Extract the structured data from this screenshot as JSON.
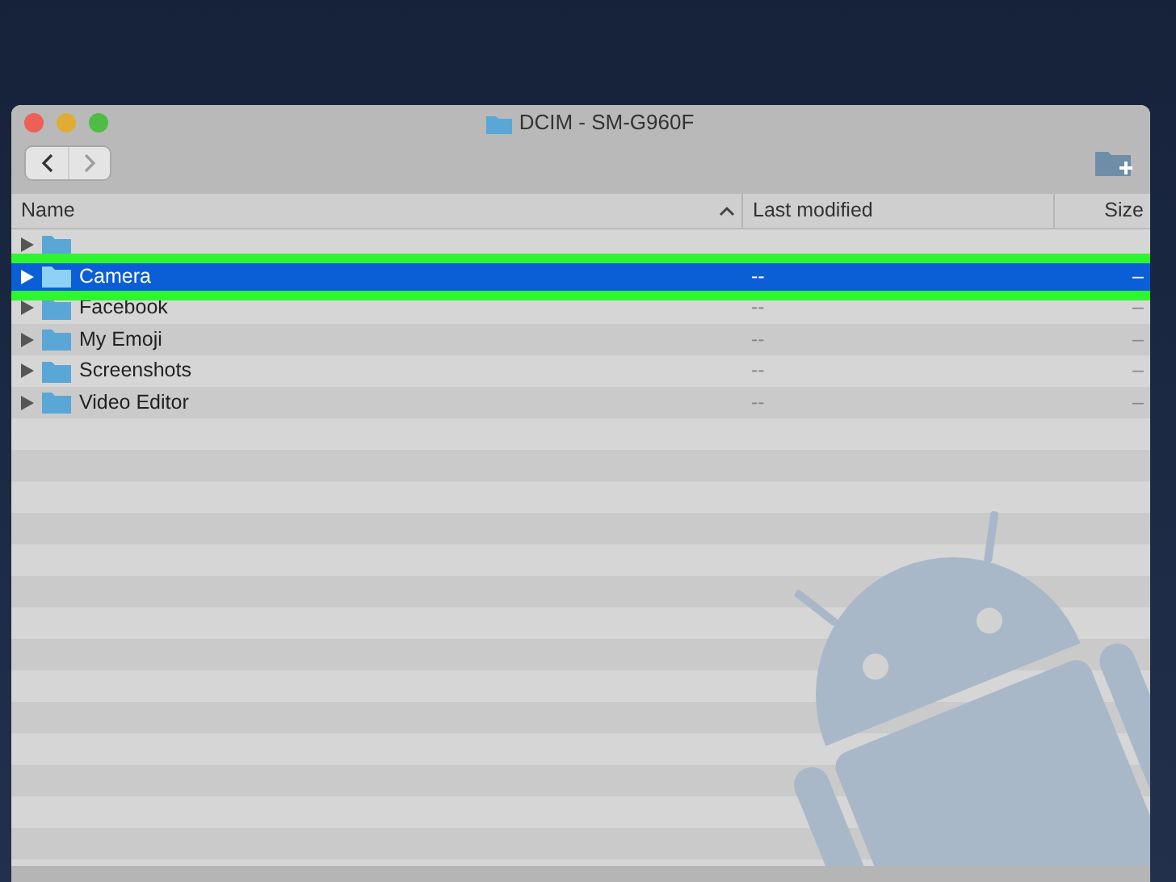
{
  "window": {
    "title": "DCIM - SM-G960F"
  },
  "toolbar": {
    "back_disabled": false,
    "forward_disabled": true
  },
  "columns": [
    {
      "label": "Name",
      "sorted": true
    },
    {
      "label": "Last modified",
      "sorted": false
    },
    {
      "label": "Size",
      "sorted": false
    }
  ],
  "rows": [
    {
      "selected": false,
      "highlighted": false
    },
    {
      "name": "Camera",
      "modified": "--",
      "size": "–",
      "selected": true,
      "highlighted": true
    },
    {
      "name": "Facebook",
      "modified": "--",
      "size": "–",
      "selected": false,
      "highlighted": false
    },
    {
      "name": "My Emoji",
      "modified": "--",
      "size": "–",
      "selected": false,
      "highlighted": false
    },
    {
      "name": "Screenshots",
      "modified": "--",
      "size": "–",
      "selected": false,
      "highlighted": false
    },
    {
      "name": "Video Editor",
      "modified": "--",
      "size": "–",
      "selected": false,
      "highlighted": false
    }
  ]
}
